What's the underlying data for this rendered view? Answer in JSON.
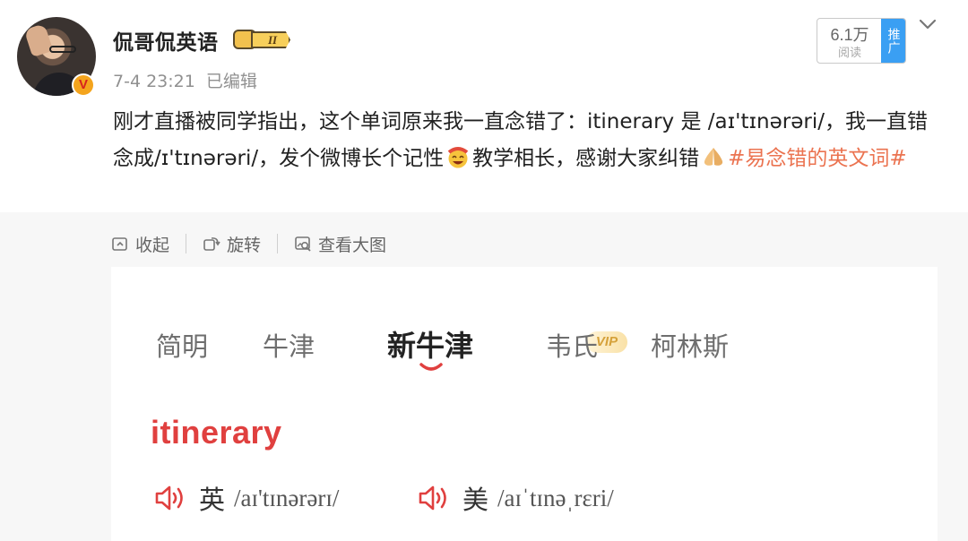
{
  "post": {
    "username": "侃哥侃英语",
    "level_badge": "II",
    "timestamp": "7-4 23:21",
    "edited_label": "已编辑",
    "reads": {
      "count": "6.1万",
      "label": "阅读",
      "promote": "推广"
    },
    "text_main": "刚才直播被同学指出，这个单词原来我一直念错了：itinerary 是 /aɪ'tɪnərəri/，我一直错念成/ɪ'tɪnərəri/，发个微博长个记性",
    "text_after_emoji": "教学相长，感谢大家纠错",
    "hashtag": "#易念错的英文词#",
    "emoji_1": "laughing-face-emoji",
    "emoji_2": "praying-hands-emoji"
  },
  "toolbar": {
    "collapse": "收起",
    "rotate": "旋转",
    "view_large": "查看大图"
  },
  "dictionary": {
    "tabs": [
      "简明",
      "牛津",
      "新牛津",
      "韦氏",
      "柯林斯"
    ],
    "active_tab": "新牛津",
    "vip_label": "VIP",
    "word": "itinerary",
    "uk_label": "英",
    "uk_ipa": "/aɪ'tɪnərərɪ/",
    "us_label": "美",
    "us_ipa": "/aɪˈtɪnəˌrɛri/",
    "accent_color": "#e0403f"
  },
  "colors": {
    "hashtag": "#eb7350",
    "promote": "#3a9ff3",
    "verified": "#f4a41d"
  }
}
